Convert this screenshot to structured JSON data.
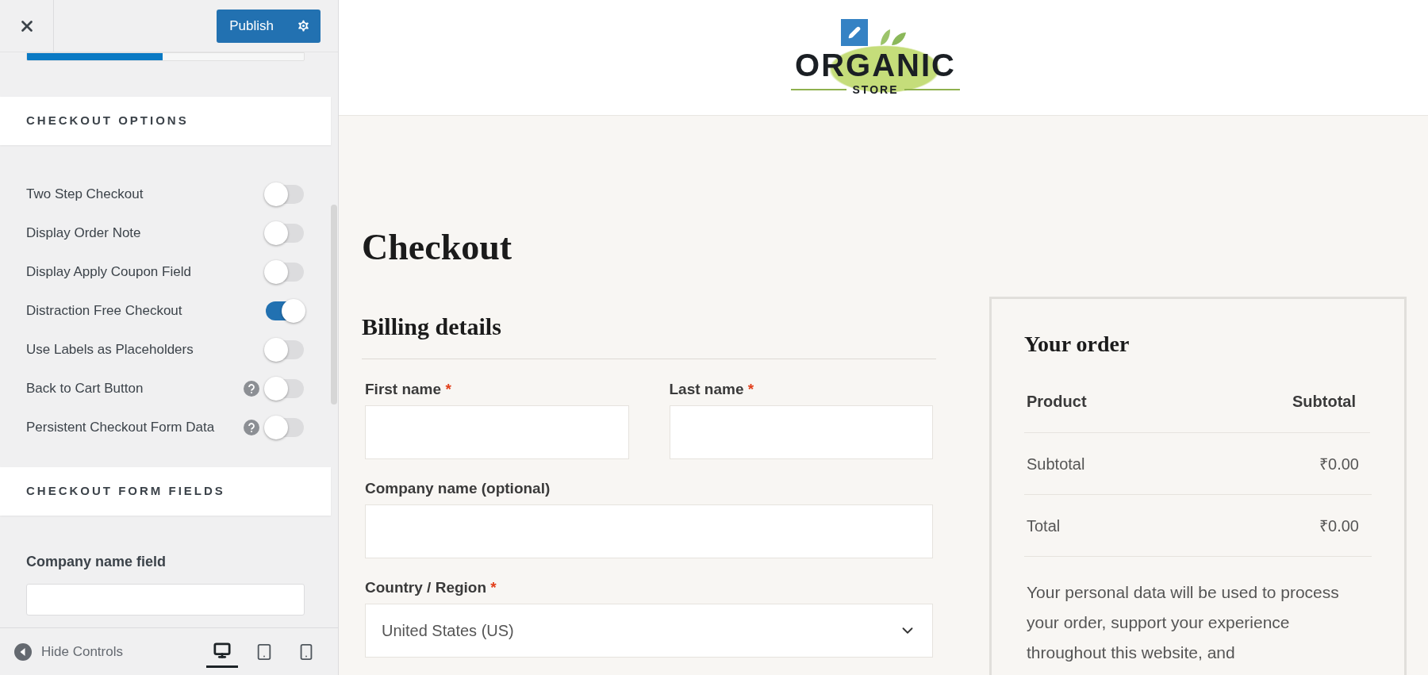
{
  "header": {
    "publish": "Publish"
  },
  "progress": {
    "level": 0.49
  },
  "options_section": {
    "title": "CHECKOUT OPTIONS",
    "toggles": [
      {
        "label": "Two Step Checkout",
        "on": false,
        "help": false
      },
      {
        "label": "Display Order Note",
        "on": false,
        "help": false
      },
      {
        "label": "Display Apply Coupon Field",
        "on": false,
        "help": false
      },
      {
        "label": "Distraction Free Checkout",
        "on": true,
        "help": false
      },
      {
        "label": "Use Labels as Placeholders",
        "on": false,
        "help": false
      },
      {
        "label": "Back to Cart Button",
        "on": false,
        "help": true
      },
      {
        "label": "Persistent Checkout Form Data",
        "on": false,
        "help": true
      }
    ]
  },
  "fields_section": {
    "title": "CHECKOUT FORM FIELDS",
    "field_label": "Company name field"
  },
  "footer": {
    "hide_controls": "Hide Controls",
    "devices": [
      {
        "kind": "desktop",
        "selected": true
      },
      {
        "kind": "tablet",
        "selected": false
      },
      {
        "kind": "mobile",
        "selected": false
      }
    ]
  },
  "preview": {
    "logo": {
      "title": "ORGANIC",
      "subtitle": "STORE"
    },
    "page_title": "Checkout",
    "billing": {
      "title": "Billing details",
      "rows": [
        [
          {
            "label": "First name",
            "mark": "*",
            "kind": "text"
          },
          {
            "label": "Last name",
            "mark": "*",
            "kind": "text"
          }
        ],
        [
          {
            "label": "Company name (optional)",
            "kind": "text"
          }
        ],
        [
          {
            "label": "Country / Region",
            "mark": "*",
            "kind": "select",
            "value": "United States (US)"
          }
        ]
      ]
    },
    "order": {
      "title": "Your order",
      "columns": [
        "Product",
        "Subtotal"
      ],
      "rows": [
        {
          "label": "Subtotal",
          "value": "₹0.00"
        },
        {
          "label": "Total",
          "value": "₹0.00"
        }
      ],
      "note": "Your personal data will be used to process your order, support your experience throughout this website, and"
    }
  }
}
